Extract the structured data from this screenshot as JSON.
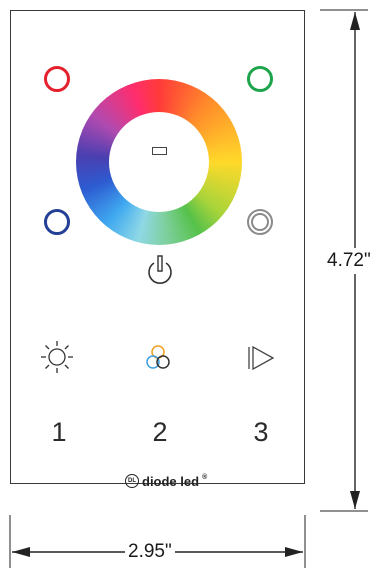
{
  "panel": {
    "color_rings": [
      {
        "name": "red-button",
        "color": "#e3202b"
      },
      {
        "name": "green-button",
        "color": "#1ea44a"
      },
      {
        "name": "blue-button",
        "color": "#243f96"
      },
      {
        "name": "white-button",
        "color": "#8a8a8a"
      }
    ],
    "icons": {
      "center": "rectangle-icon",
      "power": "power-icon",
      "brightness": "sun-icon",
      "color_mix": "three-circles-icon",
      "play": "play-icon"
    },
    "zone_labels": [
      "1",
      "2",
      "3"
    ],
    "brand": {
      "logo_text": "DL",
      "name": "diode led",
      "mark": "®"
    }
  },
  "dimensions": {
    "height": "4.72\"",
    "width": "2.95\""
  }
}
